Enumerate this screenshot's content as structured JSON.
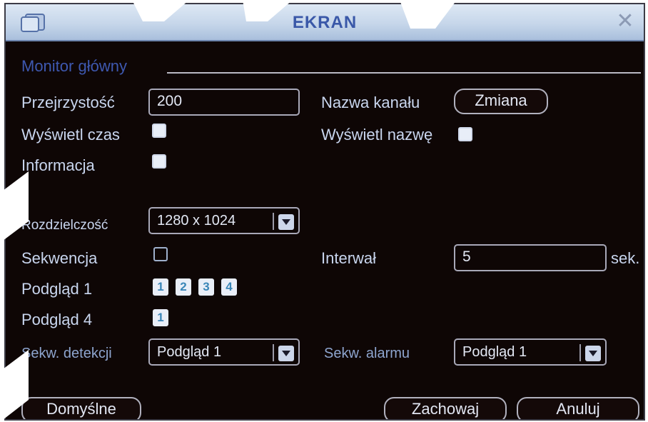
{
  "window": {
    "title": "EKRAN",
    "close_icon": "close-icon"
  },
  "section": {
    "title": "Monitor główny"
  },
  "fields": {
    "transparency": {
      "label": "Przejrzystość",
      "value": "200"
    },
    "channel_name": {
      "label": "Nazwa kanału",
      "button": "Zmiana"
    },
    "show_time": {
      "label": "Wyświetl czas",
      "checked": true
    },
    "show_name": {
      "label": "Wyświetl nazwę",
      "checked": true
    },
    "information": {
      "label": "Informacja",
      "checked": true
    },
    "resolution": {
      "label": "Rozdzielczość",
      "value": "1280 x 1024"
    },
    "sequence": {
      "label": "Sekwencja",
      "checked": false
    },
    "interval": {
      "label": "Interwał",
      "value": "5",
      "unit": "sek."
    },
    "preview1": {
      "label": "Podgląd 1",
      "options": [
        "1",
        "2",
        "3",
        "4"
      ]
    },
    "preview4": {
      "label": "Podgląd 4",
      "options": [
        "1"
      ]
    },
    "motion_seq": {
      "label": "Sekw. detekcji",
      "value": "Podgląd 1"
    },
    "alarm_seq": {
      "label": "Sekw. alarmu",
      "value": "Podgląd 1"
    }
  },
  "buttons": {
    "default": "Domyślne",
    "save": "Zachowaj",
    "cancel": "Anuluj"
  },
  "colors": {
    "background": "#0e0605",
    "accent": "#3e58b0",
    "label": "#c9d6ef"
  }
}
